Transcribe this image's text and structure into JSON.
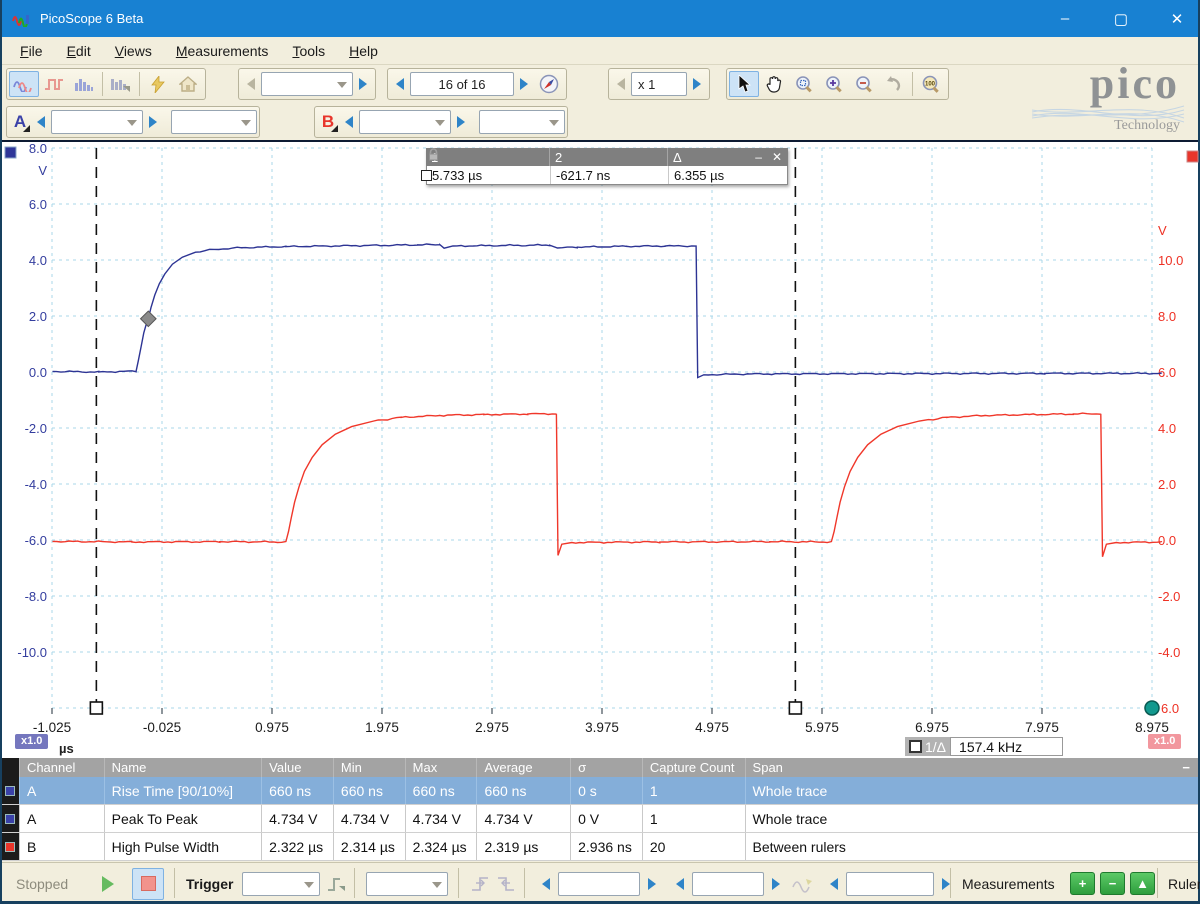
{
  "window": {
    "title": "PicoScope 6 Beta",
    "minimize": "–",
    "maximize": "▢",
    "close": "✕"
  },
  "menu": {
    "items": [
      "File",
      "Edit",
      "Views",
      "Measurements",
      "Tools",
      "Help"
    ]
  },
  "toolbar": {
    "buffer_value": "16 of 16",
    "zoom_factor_value": "x 1",
    "logo_brand": "pico",
    "logo_sub": "Technology"
  },
  "channels": {
    "a": "A",
    "b": "B"
  },
  "ruler_legend": {
    "headers": [
      "1",
      "2",
      "Δ"
    ],
    "values": [
      "5.733 µs",
      "-621.7 ns",
      "6.355 µs"
    ],
    "minimize": "–",
    "close": "✕"
  },
  "scope": {
    "left_axis": {
      "unit": "V",
      "color": "#333d9e",
      "ticks": [
        "8.0",
        "6.0",
        "4.0",
        "2.0",
        "0.0",
        "-2.0",
        "-4.0",
        "-6.0",
        "-8.0",
        "-10.0"
      ]
    },
    "right_axis": {
      "unit": "V",
      "color": "#ee3124",
      "ticks": [
        "10.0",
        "8.0",
        "6.0",
        "4.0",
        "2.0",
        "0.0",
        "-2.0",
        "-4.0"
      ],
      "bottom_tick": "6.0"
    },
    "x_ticks": [
      "-1.025",
      "-0.025",
      "0.975",
      "1.975",
      "2.975",
      "3.975",
      "4.975",
      "5.975",
      "6.975",
      "7.975",
      "8.975"
    ],
    "x_unit": "µs",
    "x_scale_left": "x1.0",
    "x_scale_right": "x1.0",
    "freq_label": "1/Δ",
    "freq_value": "157.4 kHz",
    "rulers_us": [
      -0.6217,
      5.733
    ],
    "trigger_marker": {
      "t": -0.15,
      "v": 1.9
    }
  },
  "chart_data": {
    "type": "line",
    "x_unit": "µs",
    "x_range": [
      -1.025,
      8.975
    ],
    "left_axis_range_top_bottom": [
      8,
      -12
    ],
    "right_axis_range_top_bottom": [
      14,
      -6
    ],
    "series": [
      {
        "name": "Channel A",
        "axis": "A",
        "color": "#2d3494",
        "points": [
          [
            -1.02,
            0.02
          ],
          [
            -0.6,
            0.0
          ],
          [
            -0.26,
            0.03
          ],
          [
            -0.24,
            0.4
          ],
          [
            -0.215,
            0.9
          ],
          [
            -0.19,
            1.4
          ],
          [
            -0.165,
            1.75
          ],
          [
            -0.15,
            1.9
          ],
          [
            -0.125,
            2.3
          ],
          [
            -0.09,
            2.75
          ],
          [
            -0.05,
            3.15
          ],
          [
            0.0,
            3.5
          ],
          [
            0.07,
            3.85
          ],
          [
            0.16,
            4.1
          ],
          [
            0.28,
            4.28
          ],
          [
            0.45,
            4.38
          ],
          [
            0.7,
            4.44
          ],
          [
            1.1,
            4.48
          ],
          [
            1.7,
            4.51
          ],
          [
            2.3,
            4.54
          ],
          [
            2.5,
            4.55
          ],
          [
            2.54,
            4.42
          ],
          [
            2.62,
            4.5
          ],
          [
            3.1,
            4.52
          ],
          [
            3.5,
            4.53
          ],
          [
            3.57,
            4.43
          ],
          [
            3.75,
            4.46
          ],
          [
            4.2,
            4.49
          ],
          [
            4.55,
            4.5
          ],
          [
            4.83,
            4.5
          ],
          [
            4.845,
            -0.2
          ],
          [
            4.9,
            -0.1
          ],
          [
            5.3,
            -0.07
          ],
          [
            6.5,
            -0.06
          ],
          [
            8.0,
            -0.05
          ],
          [
            9.06,
            -0.05
          ]
        ]
      },
      {
        "name": "Channel B",
        "axis": "B",
        "color": "#f0372a",
        "points": [
          [
            -1.02,
            -0.05
          ],
          [
            -0.3,
            -0.07
          ],
          [
            0.5,
            -0.06
          ],
          [
            1.1,
            -0.07
          ],
          [
            1.125,
            0.3
          ],
          [
            1.15,
            0.8
          ],
          [
            1.18,
            1.35
          ],
          [
            1.22,
            1.9
          ],
          [
            1.27,
            2.45
          ],
          [
            1.34,
            2.95
          ],
          [
            1.43,
            3.4
          ],
          [
            1.55,
            3.78
          ],
          [
            1.7,
            4.05
          ],
          [
            1.9,
            4.25
          ],
          [
            2.15,
            4.38
          ],
          [
            2.5,
            4.45
          ],
          [
            2.9,
            4.48
          ],
          [
            3.3,
            4.5
          ],
          [
            3.56,
            4.51
          ],
          [
            3.575,
            -0.55
          ],
          [
            3.61,
            -0.15
          ],
          [
            3.7,
            -0.09
          ],
          [
            4.5,
            -0.07
          ],
          [
            5.5,
            -0.06
          ],
          [
            6.06,
            -0.07
          ],
          [
            6.085,
            0.3
          ],
          [
            6.11,
            0.8
          ],
          [
            6.14,
            1.35
          ],
          [
            6.18,
            1.9
          ],
          [
            6.23,
            2.45
          ],
          [
            6.3,
            2.95
          ],
          [
            6.39,
            3.4
          ],
          [
            6.51,
            3.78
          ],
          [
            6.66,
            4.05
          ],
          [
            6.86,
            4.25
          ],
          [
            7.11,
            4.38
          ],
          [
            7.46,
            4.45
          ],
          [
            7.86,
            4.48
          ],
          [
            8.26,
            4.5
          ],
          [
            8.51,
            4.51
          ],
          [
            8.525,
            -0.6
          ],
          [
            8.56,
            -0.15
          ],
          [
            8.65,
            -0.09
          ],
          [
            9.06,
            -0.07
          ]
        ]
      }
    ]
  },
  "measurements_table": {
    "headers": [
      "Channel",
      "Name",
      "Value",
      "Min",
      "Max",
      "Average",
      "σ",
      "Capture Count",
      "Span"
    ],
    "rows": [
      {
        "channel": "A",
        "chip_color": "#3a41a8",
        "name": "Rise Time  [90/10%]",
        "value": "660 ns",
        "min": "660 ns",
        "max": "660 ns",
        "average": "660 ns",
        "sigma": "0 s",
        "capture_count": "1",
        "span": "Whole trace",
        "selected": true
      },
      {
        "channel": "A",
        "chip_color": "#3a41a8",
        "name": "Peak To Peak",
        "value": "4.734 V",
        "min": "4.734 V",
        "max": "4.734 V",
        "average": "4.734 V",
        "sigma": "0 V",
        "capture_count": "1",
        "span": "Whole trace",
        "selected": false
      },
      {
        "channel": "B",
        "chip_color": "#e8352b",
        "name": "High Pulse Width",
        "value": "2.322 µs",
        "min": "2.314 µs",
        "max": "2.324 µs",
        "average": "2.319 µs",
        "sigma": "2.936 ns",
        "capture_count": "20",
        "span": "Between rulers",
        "selected": false
      }
    ]
  },
  "status_bar": {
    "state": "Stopped",
    "trigger_label": "Trigger",
    "measurements_label": "Measurements",
    "rulers_label": "Rulers"
  }
}
